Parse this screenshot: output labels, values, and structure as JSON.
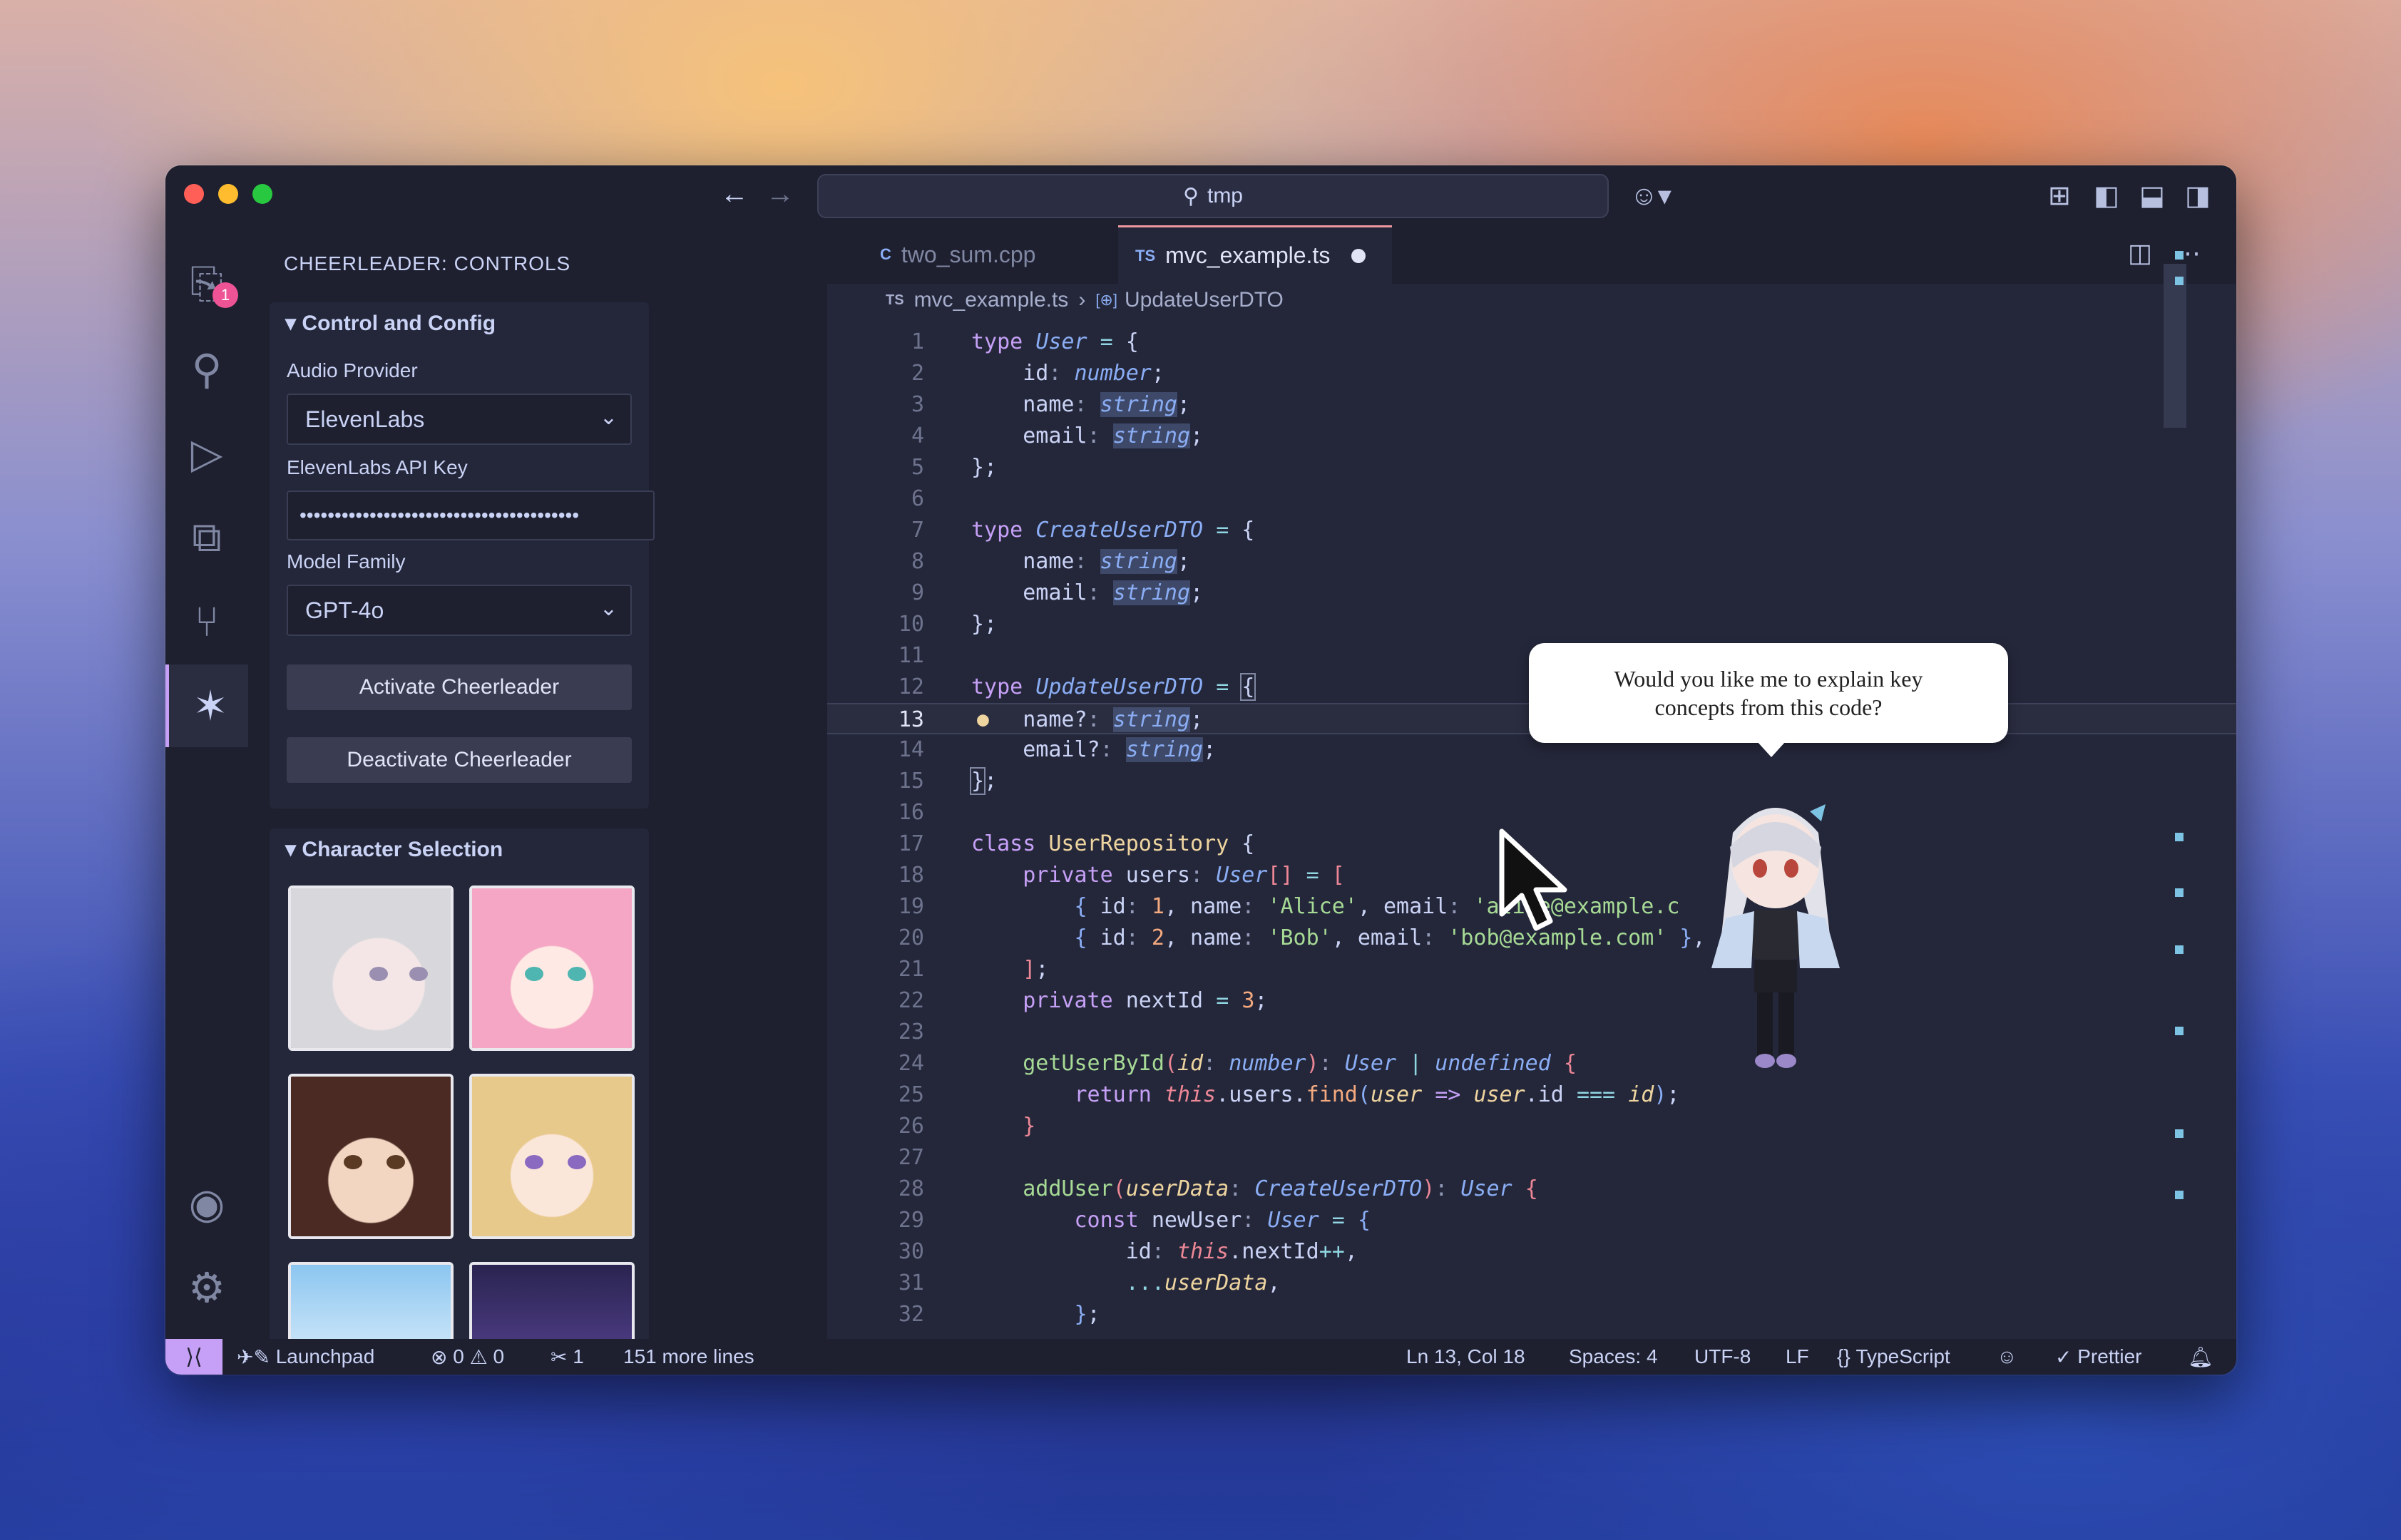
{
  "titlebar": {
    "search_text": "tmp"
  },
  "activity": {
    "explorer_badge": "1"
  },
  "sidebar": {
    "title": "CHEERLEADER: CONTROLS",
    "control_section": "Control and Config",
    "audio_provider_label": "Audio Provider",
    "audio_provider_value": "ElevenLabs",
    "api_key_label": "ElevenLabs API Key",
    "api_key_value": "••••••••••••••••••••••••••••••••••••••••",
    "model_family_label": "Model Family",
    "model_family_value": "GPT-4o",
    "activate_label": "Activate Cheerleader",
    "deactivate_label": "Deactivate Cheerleader",
    "character_section": "Character Selection"
  },
  "tabs": [
    {
      "icon": "C",
      "label": "two_sum.cpp"
    },
    {
      "icon": "TS",
      "label": "mvc_example.ts"
    }
  ],
  "breadcrumb": {
    "icon": "TS",
    "file": "mvc_example.ts",
    "symbol": "UpdateUserDTO"
  },
  "code": {
    "line_numbers": [
      "1",
      "2",
      "3",
      "4",
      "5",
      "6",
      "7",
      "8",
      "9",
      "10",
      "11",
      "12",
      "13",
      "14",
      "15",
      "16",
      "17",
      "18",
      "19",
      "20",
      "21",
      "22",
      "23",
      "24",
      "25",
      "26",
      "27",
      "28",
      "29",
      "30",
      "31",
      "32"
    ]
  },
  "bubble": {
    "text": "Would you like me to explain key concepts from this code?"
  },
  "status": {
    "launchpad": "Launchpad",
    "errors": "0",
    "warnings": "0",
    "tools": "1",
    "more_lines": "151 more lines",
    "position": "Ln 13, Col 18",
    "spaces": "Spaces: 4",
    "encoding": "UTF-8",
    "eol": "LF",
    "language": "TypeScript",
    "prettier": "Prettier"
  },
  "colors": {
    "accent": "#c6a0f6",
    "background": "#24273a",
    "tab_modified": "#ee99a0"
  }
}
